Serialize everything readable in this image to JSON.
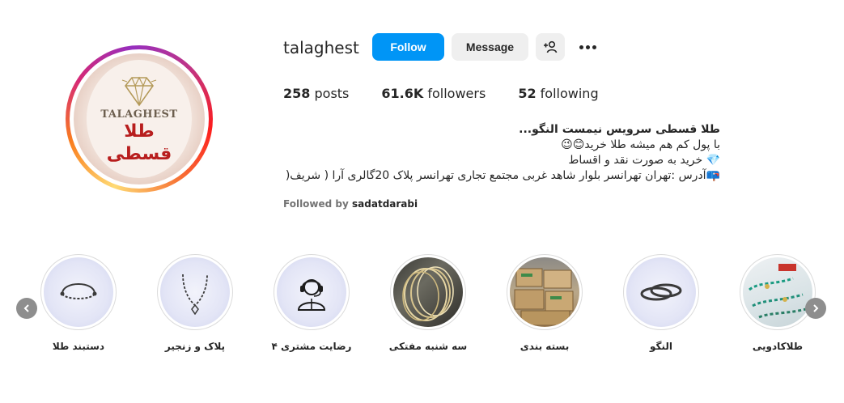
{
  "profile": {
    "username": "talaghest",
    "follow_label": "Follow",
    "message_label": "Message",
    "avatar": {
      "logo_latin": "TALAGHEST",
      "logo_fa_line1": "طلا",
      "logo_fa_line2": "قسطی"
    }
  },
  "stats": {
    "posts_value": "258",
    "posts_label": "posts",
    "followers_value": "61.6K",
    "followers_label": "followers",
    "following_value": "52",
    "following_label": "following"
  },
  "bio": {
    "title": "طلا قسطی سرویس نیمست النگو...",
    "line1": "با پول کم هم میشه طلا خرید😊😉",
    "line2": "💎 خرید به صورت نقد و اقساط",
    "line3": "📪آدرس :تهران تهرانسر بلوار شاهد غربی مجتمع تجاری تهرانسر پلاک 20گالری آرا ( شریف("
  },
  "followed_by": {
    "prefix": "Followed by",
    "name": "sadatdarabi"
  },
  "highlights": [
    {
      "label": "دستبند طلا",
      "icon": "bracelet-icon"
    },
    {
      "label": "پلاک و زنجیر",
      "icon": "necklace-icon"
    },
    {
      "label": "رضایت مشتری ۴",
      "icon": "support-agent-icon"
    },
    {
      "label": "سه شنبه مفتکی",
      "icon": "photo-bangles"
    },
    {
      "label": "بسته بندی",
      "icon": "photo-boxes"
    },
    {
      "label": "النگو",
      "icon": "bangle-icon"
    },
    {
      "label": "طلاکادویی",
      "icon": "photo-gift-bracelets"
    }
  ],
  "colors": {
    "accent": "#0095f6",
    "logo_red": "#b81e1e"
  }
}
